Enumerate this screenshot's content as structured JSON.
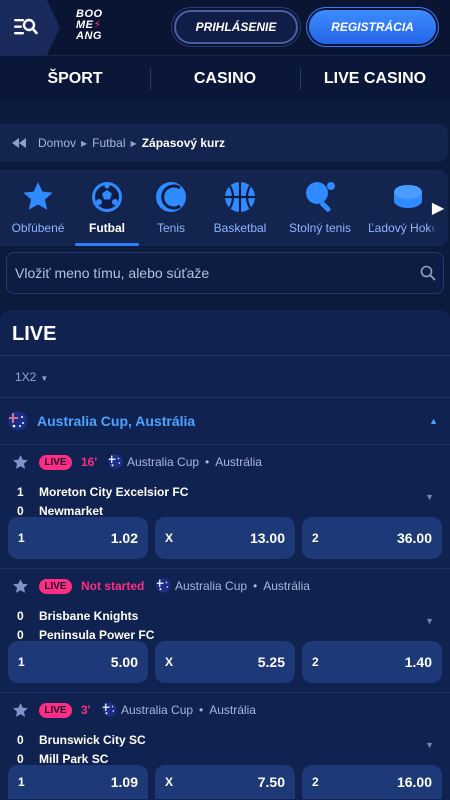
{
  "header": {
    "logo_lines": [
      "BOO",
      "ME",
      "ANG"
    ],
    "login_label": "PRIHLÁSENIE",
    "register_label": "REGISTRÁCIA"
  },
  "nav": [
    "ŠPORT",
    "CASINO",
    "LIVE CASINO"
  ],
  "breadcrumb": {
    "items": [
      "Domov",
      "Futbal"
    ],
    "current": "Zápasový kurz"
  },
  "sports": [
    {
      "label": "Obľúbené",
      "icon": "star-icon"
    },
    {
      "label": "Futbal",
      "icon": "soccer-ball-icon",
      "active": true
    },
    {
      "label": "Tenis",
      "icon": "tennis-ball-icon"
    },
    {
      "label": "Basketbal",
      "icon": "basketball-icon"
    },
    {
      "label": "Stolný tenis",
      "icon": "table-tennis-icon"
    },
    {
      "label": "Ľadový Hokej",
      "icon": "ice-hockey-icon"
    }
  ],
  "search": {
    "placeholder": "Vložiť meno tímu, alebo súťaže"
  },
  "live": {
    "title": "LIVE",
    "market": "1X2",
    "league": "Australia Cup, Austrália",
    "matches": [
      {
        "badge": "LIVE",
        "status": "16'",
        "competition": "Australia Cup",
        "country": "Austrália",
        "home": {
          "score": "1",
          "name": "Moreton City Excelsior FC"
        },
        "away": {
          "score": "0",
          "name": "Newmarket"
        },
        "odds": [
          {
            "label": "1",
            "value": "1.02"
          },
          {
            "label": "X",
            "value": "13.00"
          },
          {
            "label": "2",
            "value": "36.00"
          }
        ]
      },
      {
        "badge": "LIVE",
        "status": "Not started",
        "competition": "Australia Cup",
        "country": "Austrália",
        "home": {
          "score": "0",
          "name": "Brisbane Knights"
        },
        "away": {
          "score": "0",
          "name": "Peninsula Power FC"
        },
        "odds": [
          {
            "label": "1",
            "value": "5.00"
          },
          {
            "label": "X",
            "value": "5.25"
          },
          {
            "label": "2",
            "value": "1.40"
          }
        ]
      },
      {
        "badge": "LIVE",
        "status": "3'",
        "competition": "Australia Cup",
        "country": "Austrália",
        "home": {
          "score": "0",
          "name": "Brunswick City SC"
        },
        "away": {
          "score": "0",
          "name": "Mill Park SC"
        },
        "odds": [
          {
            "label": "1",
            "value": "1.09"
          },
          {
            "label": "X",
            "value": "7.50"
          },
          {
            "label": "2",
            "value": "16.00"
          }
        ]
      }
    ]
  },
  "colors": {
    "background": "#0b1a3d",
    "accent": "#2f7cff",
    "live": "#ff2d84",
    "league": "#4ea3ff"
  }
}
